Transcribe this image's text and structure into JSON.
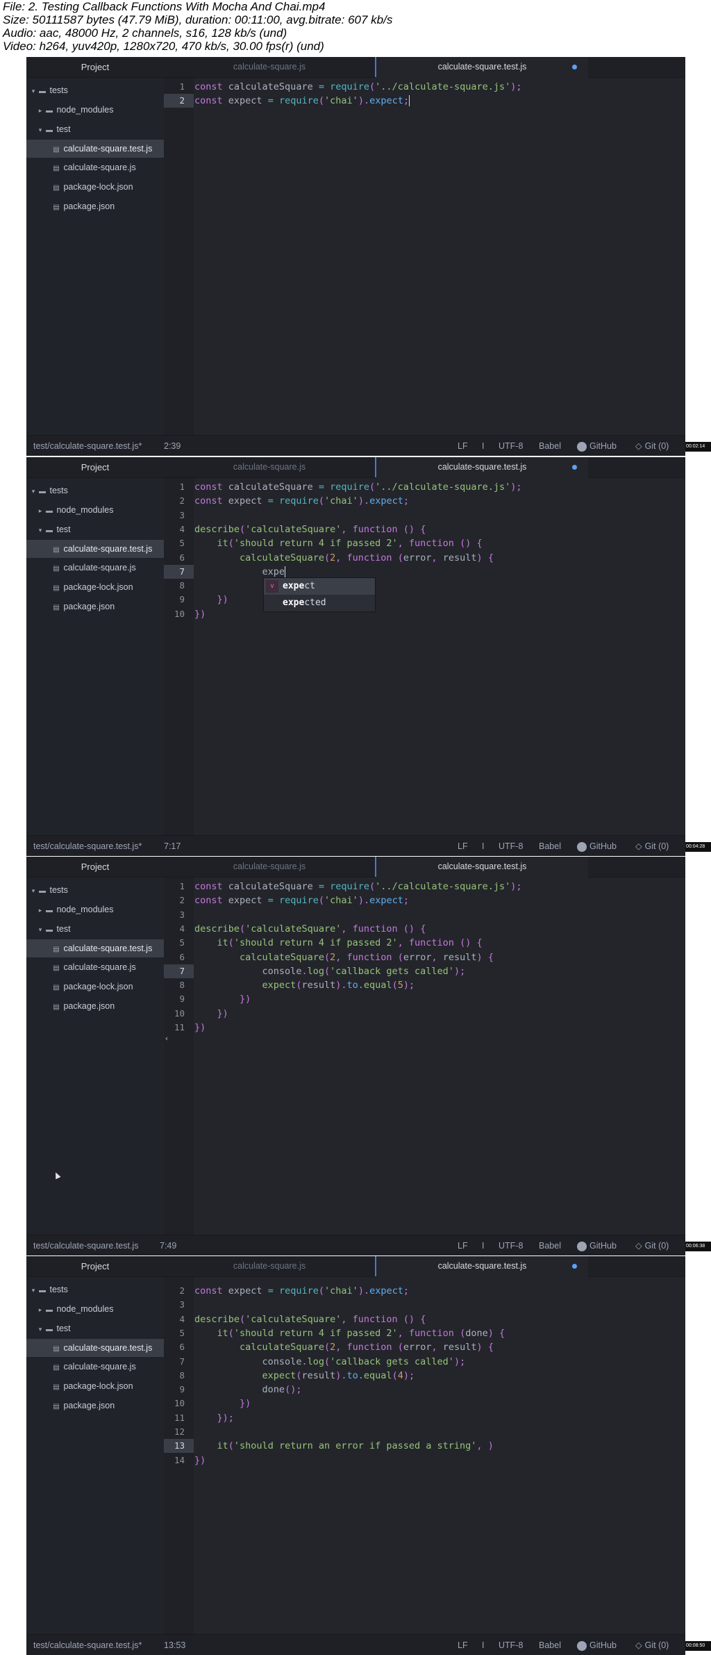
{
  "header": {
    "file": "File: 2. Testing Callback Functions With Mocha And Chai.mp4",
    "size": "Size: 50111587 bytes (47.79 MiB), duration: 00:11:00, avg.bitrate: 607 kb/s",
    "audio": "Audio: aac, 48000 Hz, 2 channels, s16, 128 kb/s (und)",
    "video": "Video: h264, yuv420p, 1280x720, 470 kb/s, 30.00 fps(r) (und)"
  },
  "colors": {
    "editor_bg": "#23252b",
    "sidebar_bg": "#21232a",
    "accent": "#4d78cc",
    "modified_dot": "#5da3f5",
    "keyword": "#c678dd",
    "string": "#98c379",
    "function": "#61afef",
    "variable": "#e06c75",
    "number": "#d19a66"
  },
  "common": {
    "project_title": "Project",
    "tab1": "calculate-square.js",
    "tab2": "calculate-square.test.js",
    "tree": [
      {
        "label": "tests",
        "icon": "folder-icon",
        "caret": "chevron-down-icon"
      },
      {
        "label": "node_modules",
        "icon": "folder-icon",
        "caret": "chevron-right-icon"
      },
      {
        "label": "test",
        "icon": "folder-icon",
        "caret": "chevron-down-icon"
      },
      {
        "label": "calculate-square.test.js",
        "icon": "file-icon"
      },
      {
        "label": "calculate-square.js",
        "icon": "file-icon"
      },
      {
        "label": "package-lock.json",
        "icon": "file-icon"
      },
      {
        "label": "package.json",
        "icon": "file-icon"
      }
    ],
    "status_lf": "LF",
    "status_sep": "I",
    "status_encoding": "UTF-8",
    "status_grammar": "Babel",
    "status_github": "GitHub",
    "status_git": "Git (0)"
  },
  "frames": [
    {
      "path": "test/calculate-square.test.js*",
      "cursor_pos": "2:39",
      "timestamp": "00:02:14",
      "modified": true
    },
    {
      "path": "test/calculate-square.test.js*",
      "cursor_pos": "7:17",
      "timestamp": "00:04:28",
      "modified": true,
      "autocomplete": [
        "expect",
        "expected"
      ]
    },
    {
      "path": "test/calculate-square.test.js",
      "cursor_pos": "7:49",
      "timestamp": "00:06:38",
      "modified": false
    },
    {
      "path": "test/calculate-square.test.js*",
      "cursor_pos": "13:53",
      "timestamp": "00:08:50",
      "modified": true
    }
  ],
  "code": {
    "f1": [
      "const calculateSquare = require('../calculate-square.js');",
      "const expect = require('chai').expect;"
    ],
    "f2": [
      "const calculateSquare = require('../calculate-square.js');",
      "const expect = require('chai').expect;",
      "",
      "describe('calculateSquare', function () {",
      "    it('should return 4 if passed 2', function () {",
      "        calculateSquare(2, function (error, result) {",
      "            expe",
      "",
      "    })",
      "})"
    ],
    "f3": [
      "const calculateSquare = require('../calculate-square.js');",
      "const expect = require('chai').expect;",
      "",
      "describe('calculateSquare', function () {",
      "    it('should return 4 if passed 2', function () {",
      "        calculateSquare(2, function (error, result) {",
      "            console.log('callback gets called');",
      "            expect(result).to.equal(5);",
      "        })",
      "    })",
      "})"
    ],
    "f4": [
      "const expect = require('chai').expect;",
      "",
      "describe('calculateSquare', function () {",
      "    it('should return 4 if passed 2', function (done) {",
      "        calculateSquare(2, function (error, result) {",
      "            console.log('callback gets called');",
      "            expect(result).to.equal(4);",
      "            done();",
      "        })",
      "    });",
      "",
      "    it('should return an error if passed a string', )",
      "})"
    ]
  }
}
